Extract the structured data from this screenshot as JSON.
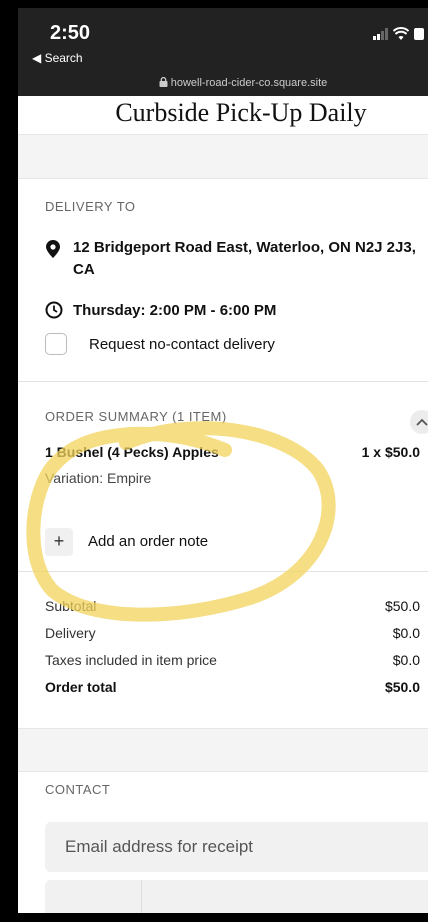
{
  "status_bar": {
    "time": "2:50",
    "back_label": "◀ Search",
    "url": "howell-road-cider-co.square.site"
  },
  "site_title": "Curbside Pick-Up Daily",
  "delivery": {
    "heading": "DELIVERY TO",
    "address_line1": "12 Bridgeport Road East, Waterloo, ON N2J 2J3,",
    "address_line2": "CA",
    "time_window": "Thursday: 2:00 PM - 6:00 PM",
    "no_contact_label": "Request no-contact delivery",
    "no_contact_checked": false
  },
  "order_summary": {
    "heading": "ORDER SUMMARY (1 ITEM)",
    "item_name": "1 Bushel (4 Pecks) Apples",
    "item_qty_price": "1 x $50.0",
    "variation": "Variation: Empire",
    "add_note_label": "Add an order note"
  },
  "totals": {
    "subtotal_label": "Subtotal",
    "subtotal_value": "$50.0",
    "delivery_label": "Delivery",
    "delivery_value": "$0.0",
    "taxes_label": "Taxes included in item price",
    "taxes_value": "$0.0",
    "order_total_label": "Order total",
    "order_total_value": "$50.0"
  },
  "contact": {
    "heading": "CONTACT",
    "email_placeholder": "Email address for receipt"
  },
  "colors": {
    "highlight": "#f2d35a",
    "status_bar": "#222222",
    "band": "#f4f4f4"
  }
}
